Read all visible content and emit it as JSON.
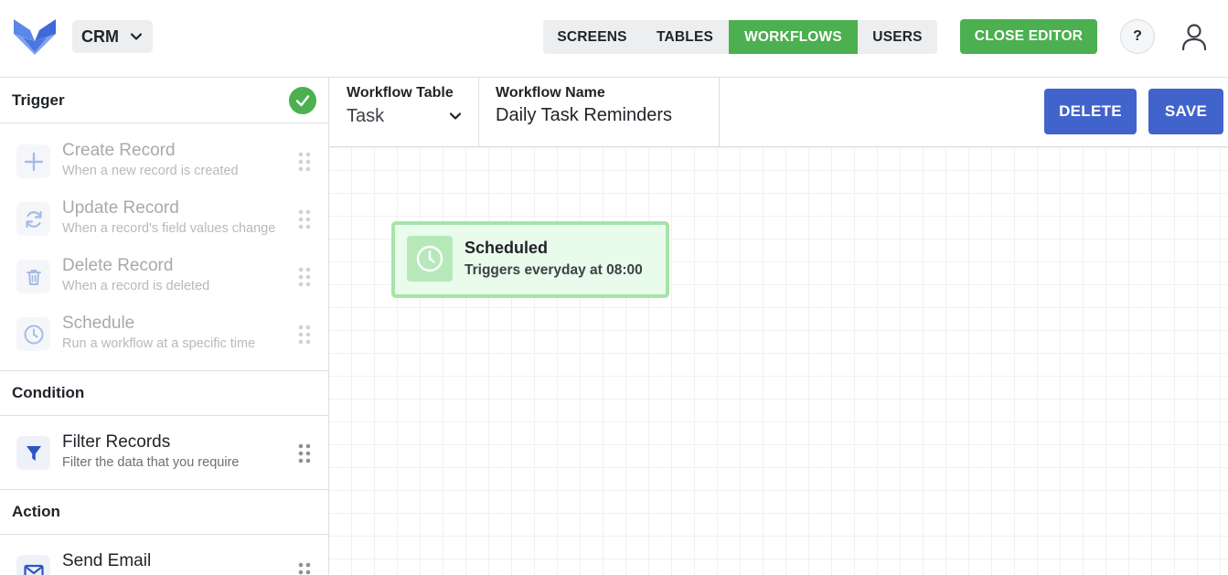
{
  "app": {
    "name": "CRM"
  },
  "nav": {
    "tabs": [
      {
        "label": "SCREENS",
        "active": false
      },
      {
        "label": "TABLES",
        "active": false
      },
      {
        "label": "WORKFLOWS",
        "active": true
      },
      {
        "label": "USERS",
        "active": false
      }
    ],
    "close_editor": "CLOSE EDITOR",
    "help": "?"
  },
  "sidebar": {
    "trigger": {
      "title": "Trigger",
      "complete": true,
      "items": [
        {
          "icon": "plus-icon",
          "name": "Create Record",
          "desc": "When a new record is created"
        },
        {
          "icon": "refresh-icon",
          "name": "Update Record",
          "desc": "When a record's field values change"
        },
        {
          "icon": "trash-icon",
          "name": "Delete Record",
          "desc": "When a record is deleted"
        },
        {
          "icon": "clock-icon",
          "name": "Schedule",
          "desc": "Run a workflow at a specific time"
        }
      ]
    },
    "condition": {
      "title": "Condition",
      "items": [
        {
          "icon": "filter-icon",
          "name": "Filter Records",
          "desc": "Filter the data that you require"
        }
      ]
    },
    "action": {
      "title": "Action",
      "items": [
        {
          "icon": "email-icon",
          "name": "Send Email",
          "desc": ""
        }
      ]
    }
  },
  "workflow": {
    "table_label": "Workflow Table",
    "table_value": "Task",
    "name_label": "Workflow Name",
    "name_value": "Daily Task Reminders",
    "delete_label": "DELETE",
    "save_label": "SAVE"
  },
  "canvas": {
    "node": {
      "icon": "clock-icon",
      "title": "Scheduled",
      "subtitle": "Triggers everyday at 08:00"
    }
  },
  "colors": {
    "accent_green": "#4caf50",
    "primary_blue": "#4163cc",
    "node_bg": "#e9fbea",
    "node_border": "#a6e4a9"
  }
}
